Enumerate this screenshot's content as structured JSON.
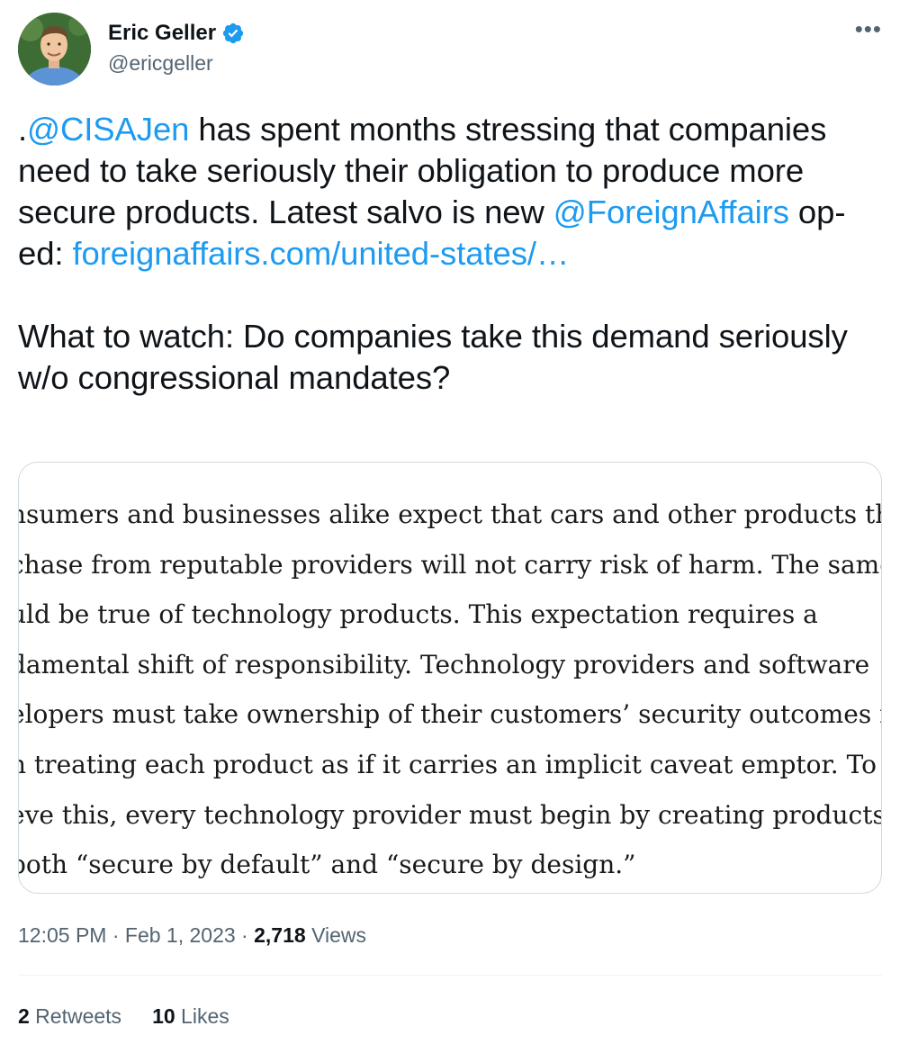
{
  "author": {
    "display_name": "Eric Geller",
    "handle": "@ericgeller",
    "verified": true,
    "verified_color": "#1d9bf0"
  },
  "more_icon": "•••",
  "tweet": {
    "p1": {
      "prefix": ".",
      "mention1": "@CISAJen",
      "text1": " has spent months stressing that companies need to take seriously their obligation to produce more secure products. Latest salvo is new ",
      "mention2": "@ForeignAffairs",
      "text2": " op-ed: ",
      "url": "foreignaffairs.com/united-states/…"
    },
    "p2": "What to watch: Do companies take this demand seriously w/o congressional mandates?"
  },
  "image_excerpt": {
    "lines": [
      "nsumers and businesses alike expect that cars and other products the",
      "chase from reputable providers will not carry risk of harm. The same",
      "uld be true of technology products. This expectation requires a",
      "damental shift of responsibility. Technology providers and software",
      "elopers must take ownership of their customers’ security outcomes ra",
      "n treating each product as if it carries an implicit caveat emptor. To",
      "eve this, every technology provider must begin by creating products",
      "both “secure by default” and “secure by design.”"
    ]
  },
  "meta": {
    "time": "12:05 PM",
    "separator": " · ",
    "date": "Feb 1, 2023",
    "views_count": "2,718",
    "views_label": " Views"
  },
  "stats": {
    "retweets_count": "2",
    "retweets_label": " Retweets",
    "likes_count": "10",
    "likes_label": " Likes"
  },
  "colors": {
    "link": "#1d9bf0",
    "text": "#0f1419",
    "secondary": "#536471"
  }
}
